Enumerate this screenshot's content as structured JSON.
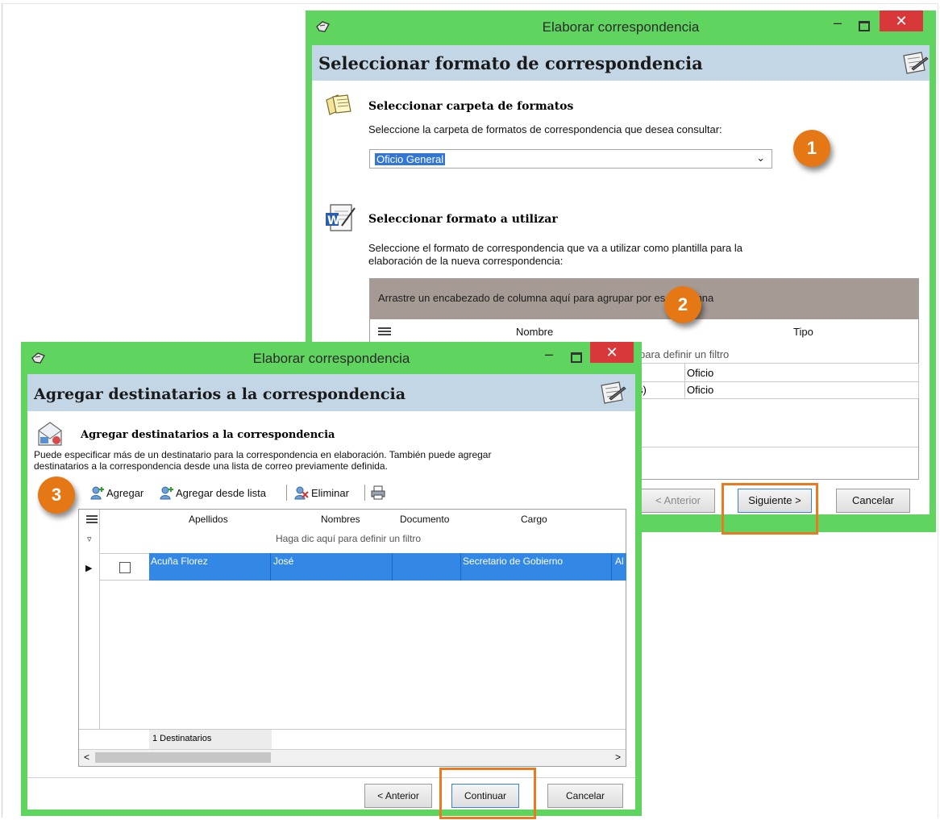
{
  "back_window": {
    "title": "Elaborar correspondencia",
    "header_title": "Seleccionar formato de correspondencia",
    "section1": {
      "title": "Seleccionar carpeta de formatos",
      "desc": "Seleccione la carpeta de formatos de correspondencia que desea consultar:",
      "select_value": "Oficio General"
    },
    "section2": {
      "title": "Seleccionar formato a utilizar",
      "desc_line1": "Seleccione el formato de correspondencia que va a utilizar como plantilla para la",
      "desc_line2": "elaboración de la nueva correspondencia:"
    },
    "grid": {
      "group_hint": "Arrastre un encabezado de columna aquí para agrupar por esa columna",
      "columns": [
        "Nombre",
        "Tipo"
      ],
      "filter_hint_partial": "para definir un filtro",
      "rows": [
        {
          "nombre_partial": "",
          "tipo": "Oficio"
        },
        {
          "nombre_partial": "s)",
          "tipo": "Oficio"
        }
      ]
    },
    "buttons": {
      "prev": "< Anterior",
      "next": "Siguiente >",
      "cancel": "Cancelar"
    }
  },
  "front_window": {
    "title": "Elaborar correspondencia",
    "header_title": "Agregar destinatarios a la correspondencia",
    "section": {
      "title": "Agregar destinatarios a la correspondencia",
      "desc_line1": "Puede especificar más de un destinatario para la correspondencia en elaboración. También puede agregar",
      "desc_line2": "destinatarios a la correspondencia desde una lista de correo previamente definida."
    },
    "toolbar": {
      "add": "Agregar",
      "add_from_list": "Agregar desde lista",
      "delete": "Eliminar"
    },
    "grid": {
      "columns": [
        "Apellidos",
        "Nombres",
        "Documento",
        "Cargo"
      ],
      "filter_hint": "Haga dic aquí para definir un filtro",
      "rows": [
        {
          "apellidos": "Acuña Florez",
          "nombres": "José",
          "documento": "",
          "cargo": "Secretario de Gobierno",
          "extra": "Al"
        }
      ],
      "footer_count": "1 Destinatarios"
    },
    "buttons": {
      "prev": "< Anterior",
      "continue": "Continuar",
      "cancel": "Cancelar"
    }
  },
  "badges": [
    "1",
    "2",
    "3"
  ],
  "colors": {
    "window_frame": "#5fd45f",
    "header_band": "#c3d6e6",
    "selection": "#3388e5",
    "callout": "#e67715"
  }
}
